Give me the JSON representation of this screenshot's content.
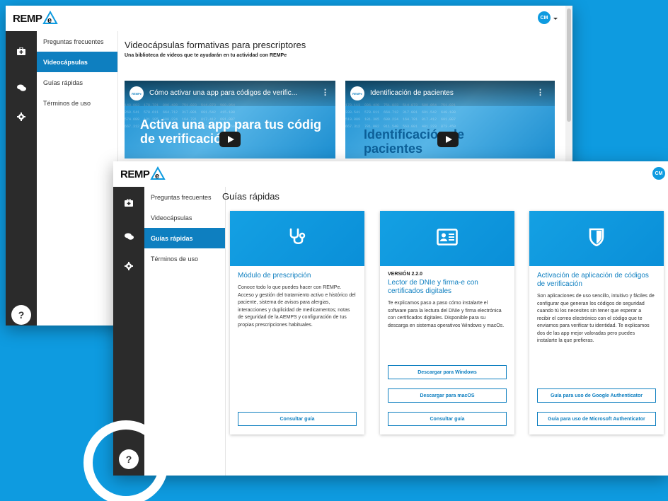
{
  "brand": {
    "name": "REMP",
    "accent": "#0e9be0",
    "nav_active": "#0e7fc0",
    "sidebar_dark": "#2b2b2b"
  },
  "user": {
    "initials": "CM"
  },
  "back_window": {
    "nav": [
      "Preguntas frecuentes",
      "Videocápsulas",
      "Guías rápidas",
      "Términos de uso"
    ],
    "active_nav": 1,
    "title": "Videocápsulas formativas para prescriptores",
    "subtitle": "Una biblioteca de videos que te ayudarán en tu actividad con REMPe",
    "videos": [
      {
        "title": "Cómo activar una app para códigos de verific...",
        "overlay": "Activa una app para tus códig de verificación",
        "chip": "REMPe"
      },
      {
        "title": "Identificación de pacientes",
        "overlay": "Identificación de pacientes",
        "chip": "REMPe"
      }
    ]
  },
  "front_window": {
    "nav": [
      "Preguntas frecuentes",
      "Videocápsulas",
      "Guías rápidas",
      "Términos de uso"
    ],
    "active_nav": 2,
    "title": "Guías rápidas",
    "help_label": "?",
    "cards": [
      {
        "icon": "stethoscope-icon",
        "version": "",
        "title": "Módulo de prescripción",
        "text": "Conoce todo lo que puedes hacer con REMPe. Acceso y gestión del tratamiento activo e histórico del paciente, sistema de avisos para alergias, interacciones y duplicidad de medicamentos; notas de seguridad de la AEMPS y configuración de tus propias prescripciones habituales.",
        "buttons": [
          "Consultar guía"
        ]
      },
      {
        "icon": "id-card-icon",
        "version": "VERSIÓN 2.2.0",
        "title": "Lector de DNIe y firma-e con certificados digitales",
        "text": "Te explicamos paso a paso cómo instalarte el software para la lectura del DNIe y firma electrónica con certificados digitales. Disponible para su descarga en sistemas operativos Windows y macOs.",
        "buttons": [
          "Descargar para Windows",
          "Descargar para macOS",
          "Consultar guía"
        ]
      },
      {
        "icon": "shield-icon",
        "version": "",
        "title": "Activación de aplicación de códigos de verificación",
        "text": "Son aplicaciones de uso sencillo, intuitivo y fáciles de configurar que generan los códigos de seguridad cuando tú los necesites sin tener que esperar a recibir el correo electrónico con el código que te enviamos para verificar tu identidad. Te explicamos dos de las app mejor valoradas pero puedes instalarte la que prefieras.",
        "buttons": [
          "Guía para uso de Google Authenticator",
          "Guía para uso de Microsoft Authenticator"
        ]
      }
    ]
  }
}
